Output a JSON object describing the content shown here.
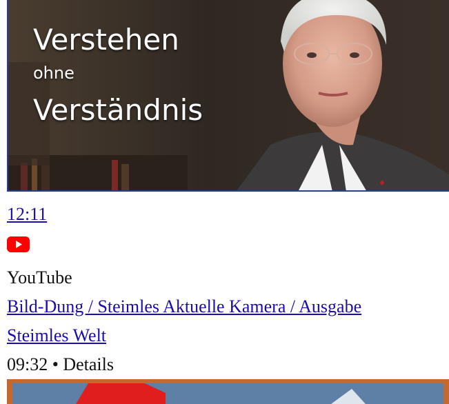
{
  "thumbnail": {
    "line1": "Verstehen",
    "line2": "ohne",
    "line3": "Verständnis"
  },
  "video": {
    "duration": "12:11",
    "platform_icon": "youtube-logo-icon",
    "source": "YouTube",
    "title": "Bild-Dung / Steimles Aktuelle Kamera / Ausgabe",
    "channel": "Steimles Welt",
    "meta": "09:32 • Details"
  },
  "colors": {
    "link": "#1a0dab",
    "youtube_red": "#ff0000",
    "border": "#2a3f8f"
  }
}
